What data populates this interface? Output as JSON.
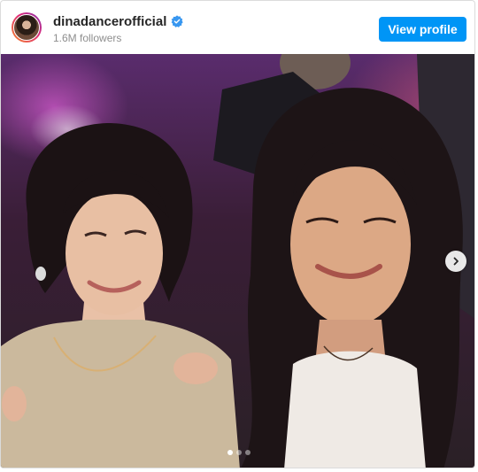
{
  "post": {
    "username": "dinadancerofficial",
    "verified": true,
    "followers": "1.6M followers",
    "view_profile_label": "View profile"
  },
  "carousel": {
    "current_slide": 1,
    "total_slides": 3,
    "next_icon": "chevron-right-icon"
  },
  "colors": {
    "button": "#0095f6",
    "verified_badge": "#3897f0"
  }
}
